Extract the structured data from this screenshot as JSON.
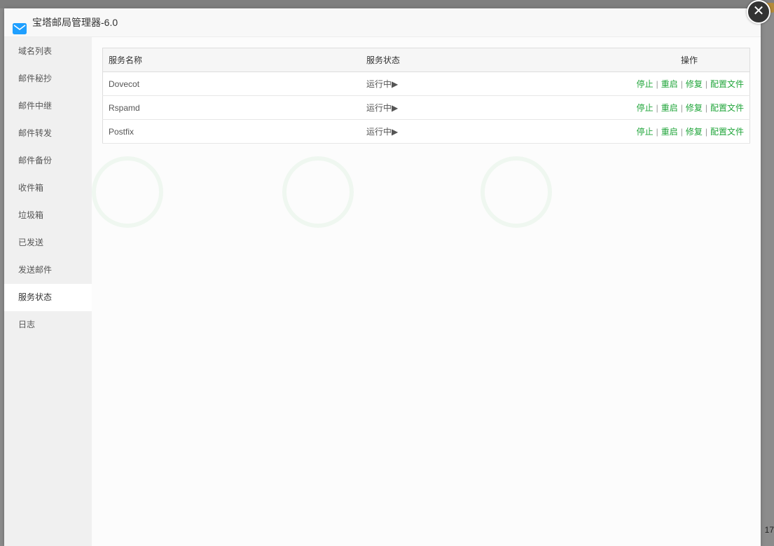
{
  "window": {
    "title": "宝塔邮局管理器-6.0",
    "icon": "mail-icon",
    "close_icon": "close-icon"
  },
  "sidebar": {
    "items": [
      {
        "label": "域名列表"
      },
      {
        "label": "邮件秘抄"
      },
      {
        "label": "邮件中继"
      },
      {
        "label": "邮件转发"
      },
      {
        "label": "邮件备份"
      },
      {
        "label": "收件箱"
      },
      {
        "label": "垃圾箱"
      },
      {
        "label": "已发送"
      },
      {
        "label": "发送邮件"
      },
      {
        "label": "服务状态",
        "active": true
      },
      {
        "label": "日志"
      }
    ]
  },
  "table": {
    "headers": {
      "name": "服务名称",
      "status": "服务状态",
      "ops": "操作"
    },
    "rows": [
      {
        "name": "Dovecot",
        "status": "运行中▶"
      },
      {
        "name": "Rspamd",
        "status": "运行中▶"
      },
      {
        "name": "Postfix",
        "status": "运行中▶"
      }
    ],
    "actions": {
      "stop": "停止",
      "restart": "重启",
      "repair": "修复",
      "config": "配置文件",
      "sep": "|"
    }
  },
  "background": {
    "corner_number": "17"
  },
  "colors": {
    "accent": "#20a53a",
    "sidebar_bg": "#f0f0f0",
    "title_bg": "#f8f8f8"
  }
}
